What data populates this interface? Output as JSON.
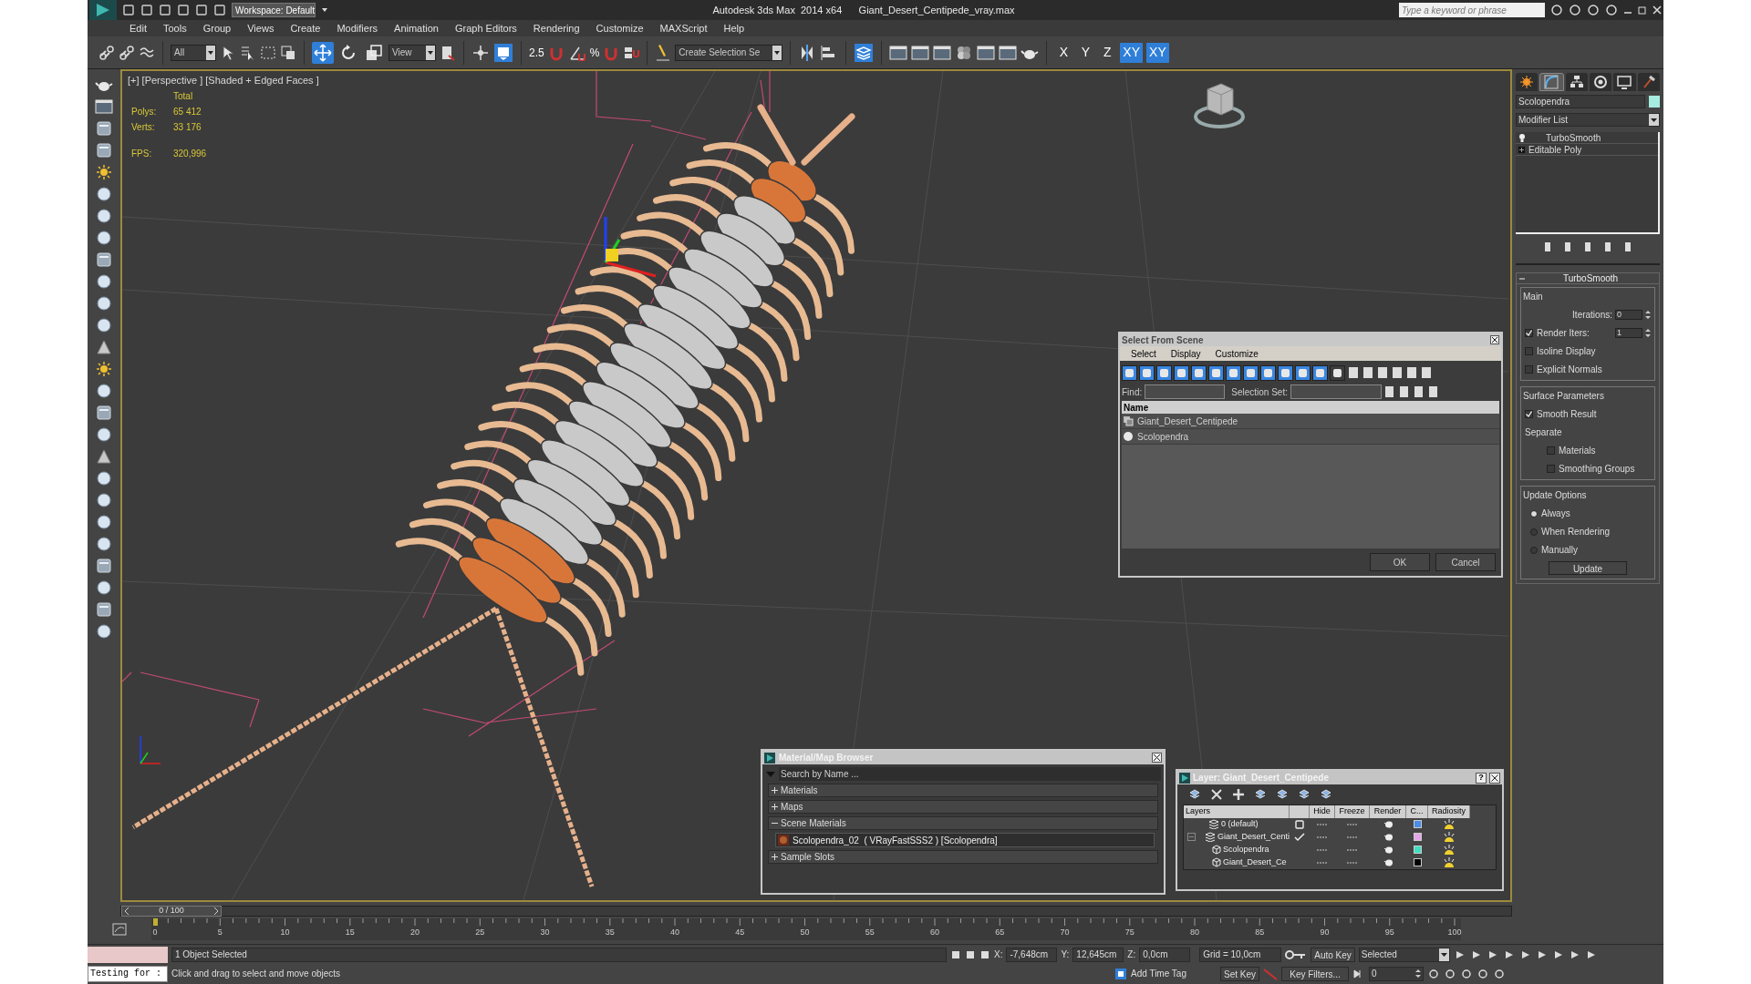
{
  "title_bar": {
    "workspace": "Workspace: Default",
    "title": "Autodesk 3ds Max  2014 x64      Giant_Desert_Centipede_vray.max",
    "search_placeholder": "Type a keyword or phrase"
  },
  "menu": [
    "Edit",
    "Tools",
    "Group",
    "Views",
    "Create",
    "Modifiers",
    "Animation",
    "Graph Editors",
    "Rendering",
    "Customize",
    "MAXScript",
    "Help"
  ],
  "main_toolbar": {
    "selection_filter": "All",
    "transform_tools": [
      {
        "selected": true
      },
      {
        "selected": false
      },
      {
        "selected": false
      }
    ],
    "reference_coordinate": "View",
    "snap_toggle": "2.5",
    "percent_snap": "%",
    "named_selection": "Create Selection Se",
    "axis_constraints": [
      {
        "label": "X",
        "selected": false
      },
      {
        "label": "Y",
        "selected": false
      },
      {
        "label": "Z",
        "selected": false
      },
      {
        "label": "XY",
        "selected": true
      },
      {
        "label": "XY",
        "selected": true
      }
    ]
  },
  "viewport": {
    "label": "[+] [Perspective ] [Shaded + Edged Faces ]",
    "stats_header": "Total",
    "stats": [
      {
        "label": "Polys:",
        "value": "65 412"
      },
      {
        "label": "Verts:",
        "value": "33 176"
      }
    ],
    "fps": {
      "label": "FPS:",
      "value": "320,996"
    }
  },
  "command_panel": {
    "tabs": [
      {
        "selected": false
      },
      {
        "selected": true
      },
      {
        "selected": false
      },
      {
        "selected": false
      },
      {
        "selected": false
      },
      {
        "selected": false
      }
    ],
    "object_name": "Scolopendra",
    "modifier_list": "Modifier List",
    "stack": [
      {
        "label": "TurboSmooth",
        "kind": "modifier"
      },
      {
        "label": "Editable Poly",
        "kind": "object"
      }
    ],
    "rollout": {
      "title": "TurboSmooth",
      "expanded": true,
      "main": {
        "title": "Main",
        "iterations": {
          "label": "Iterations:",
          "value": "0"
        },
        "render_iters": {
          "label": "Render Iters:",
          "value": "1",
          "checked": true
        },
        "checkboxes": [
          {
            "label": "Isoline Display",
            "checked": false
          },
          {
            "label": "Explicit Normals",
            "checked": false
          }
        ]
      },
      "surface": {
        "title": "Surface Parameters",
        "smooth_result": {
          "label": "Smooth Result",
          "checked": true
        },
        "separate": "Separate",
        "checkboxes": [
          {
            "label": "Materials",
            "checked": false
          },
          {
            "label": "Smoothing Groups",
            "checked": false
          }
        ]
      },
      "update": {
        "title": "Update Options",
        "radios": [
          {
            "label": "Always",
            "selected": true
          },
          {
            "label": "When Rendering",
            "selected": false
          },
          {
            "label": "Manually",
            "selected": false
          }
        ],
        "button": "Update"
      }
    }
  },
  "select_dialog": {
    "title": "Select From Scene",
    "menu": [
      "Select",
      "Display",
      "Customize"
    ],
    "filter_toggles": [
      {
        "on": true
      },
      {
        "on": true
      },
      {
        "on": true
      },
      {
        "on": true
      },
      {
        "on": true
      },
      {
        "on": true
      },
      {
        "on": true
      },
      {
        "on": true
      },
      {
        "on": true
      },
      {
        "on": true
      },
      {
        "on": true
      },
      {
        "on": true
      },
      {
        "on": false
      }
    ],
    "find_label": "Find:",
    "selection_set_label": "Selection Set:",
    "column": "Name",
    "rows": [
      {
        "name": "Giant_Desert_Centipede",
        "kind": "group"
      },
      {
        "name": "Scolopendra",
        "kind": "geometry"
      }
    ],
    "buttons": [
      "OK",
      "Cancel"
    ]
  },
  "material_browser": {
    "title": "Material/Map Browser",
    "search_placeholder": "Search by Name ...",
    "sections": [
      {
        "label": "Materials",
        "expanded": false
      },
      {
        "label": "Maps",
        "expanded": false
      },
      {
        "label": "Scene Materials",
        "expanded": true,
        "items": [
          "Scolopendra_02  ( VRayFastSSS2 ) [Scolopendra]"
        ]
      },
      {
        "label": "Sample Slots",
        "expanded": false
      }
    ]
  },
  "layer_dialog": {
    "title": "Layer: Giant_Desert_Centipede",
    "help": "?",
    "columns": [
      "Layers",
      "Hide",
      "Freeze",
      "Render",
      "C...",
      "Radiosity"
    ],
    "rows": [
      {
        "name": "0 (default)",
        "kind": "layer",
        "current": false,
        "color": "#4a8ee8"
      },
      {
        "name": "Giant_Desert_Centi",
        "kind": "layer",
        "current": true,
        "expanded": true,
        "color": "#e6a6ec",
        "children": [
          {
            "name": "Scolopendra",
            "kind": "object",
            "color": "#40e0c0"
          },
          {
            "name": "Giant_Desert_Ce",
            "kind": "object",
            "color": "#000000"
          }
        ]
      }
    ]
  },
  "timeline": {
    "slider": "0 / 100",
    "ticks": [
      "0",
      "5",
      "10",
      "15",
      "20",
      "25",
      "30",
      "35",
      "40",
      "45",
      "50",
      "55",
      "60",
      "65",
      "70",
      "75",
      "80",
      "85",
      "90",
      "95",
      "100"
    ]
  },
  "status_bar": {
    "listener": "Testing for :",
    "selection": "1 Object Selected",
    "prompt": "Click and drag to select and move objects",
    "x_label": "X:",
    "x": "-7,648cm",
    "y_label": "Y:",
    "y": "12,645cm",
    "z_label": "Z:",
    "z": "0,0cm",
    "grid": "Grid = 10,0cm",
    "add_time_tag": "Add Time Tag",
    "auto_key": "Auto Key",
    "set_key": "Set Key",
    "key_mode": "Selected",
    "key_filters": "Key Filters...",
    "frame": "0"
  }
}
